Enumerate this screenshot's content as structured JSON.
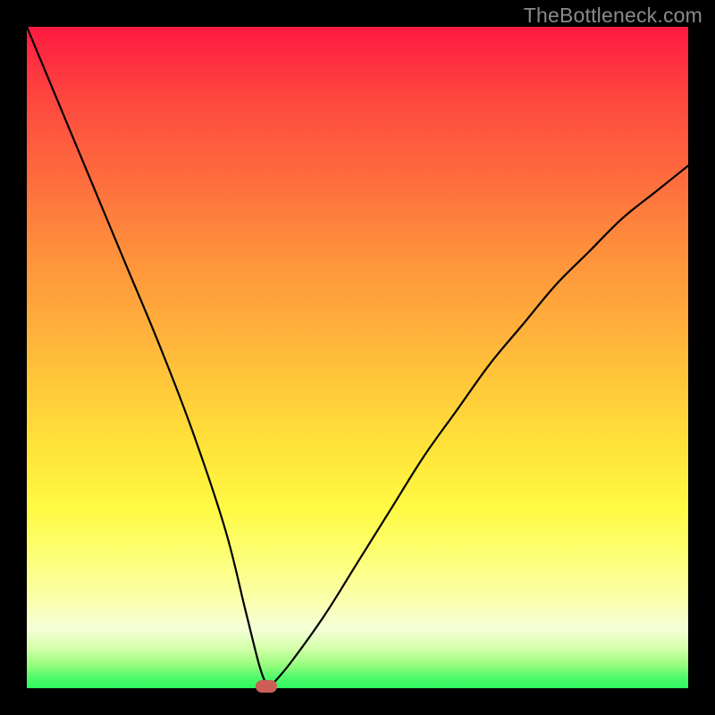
{
  "attribution": "TheBottleneck.com",
  "chart_data": {
    "type": "line",
    "title": "",
    "xlabel": "",
    "ylabel": "",
    "xlim": [
      0,
      100
    ],
    "ylim": [
      0,
      100
    ],
    "legend": false,
    "grid": false,
    "series": [
      {
        "name": "bottleneck-curve",
        "x": [
          0,
          5,
          10,
          15,
          20,
          25,
          30,
          33,
          35,
          36,
          36.5,
          37.5,
          40,
          45,
          50,
          55,
          60,
          65,
          70,
          75,
          80,
          85,
          90,
          95,
          100
        ],
        "values": [
          100,
          88,
          76,
          64,
          52,
          39,
          24,
          12,
          4,
          1,
          0,
          1,
          4,
          11,
          19,
          27,
          35,
          42,
          49,
          55,
          61,
          66,
          71,
          75,
          79
        ]
      }
    ],
    "marker": {
      "x": 36.2,
      "y": 0
    },
    "background_gradient": {
      "top": "#fe1a41",
      "mid": "#ffe439",
      "bottom": "#2cf75e"
    },
    "frame_color": "#000000"
  }
}
